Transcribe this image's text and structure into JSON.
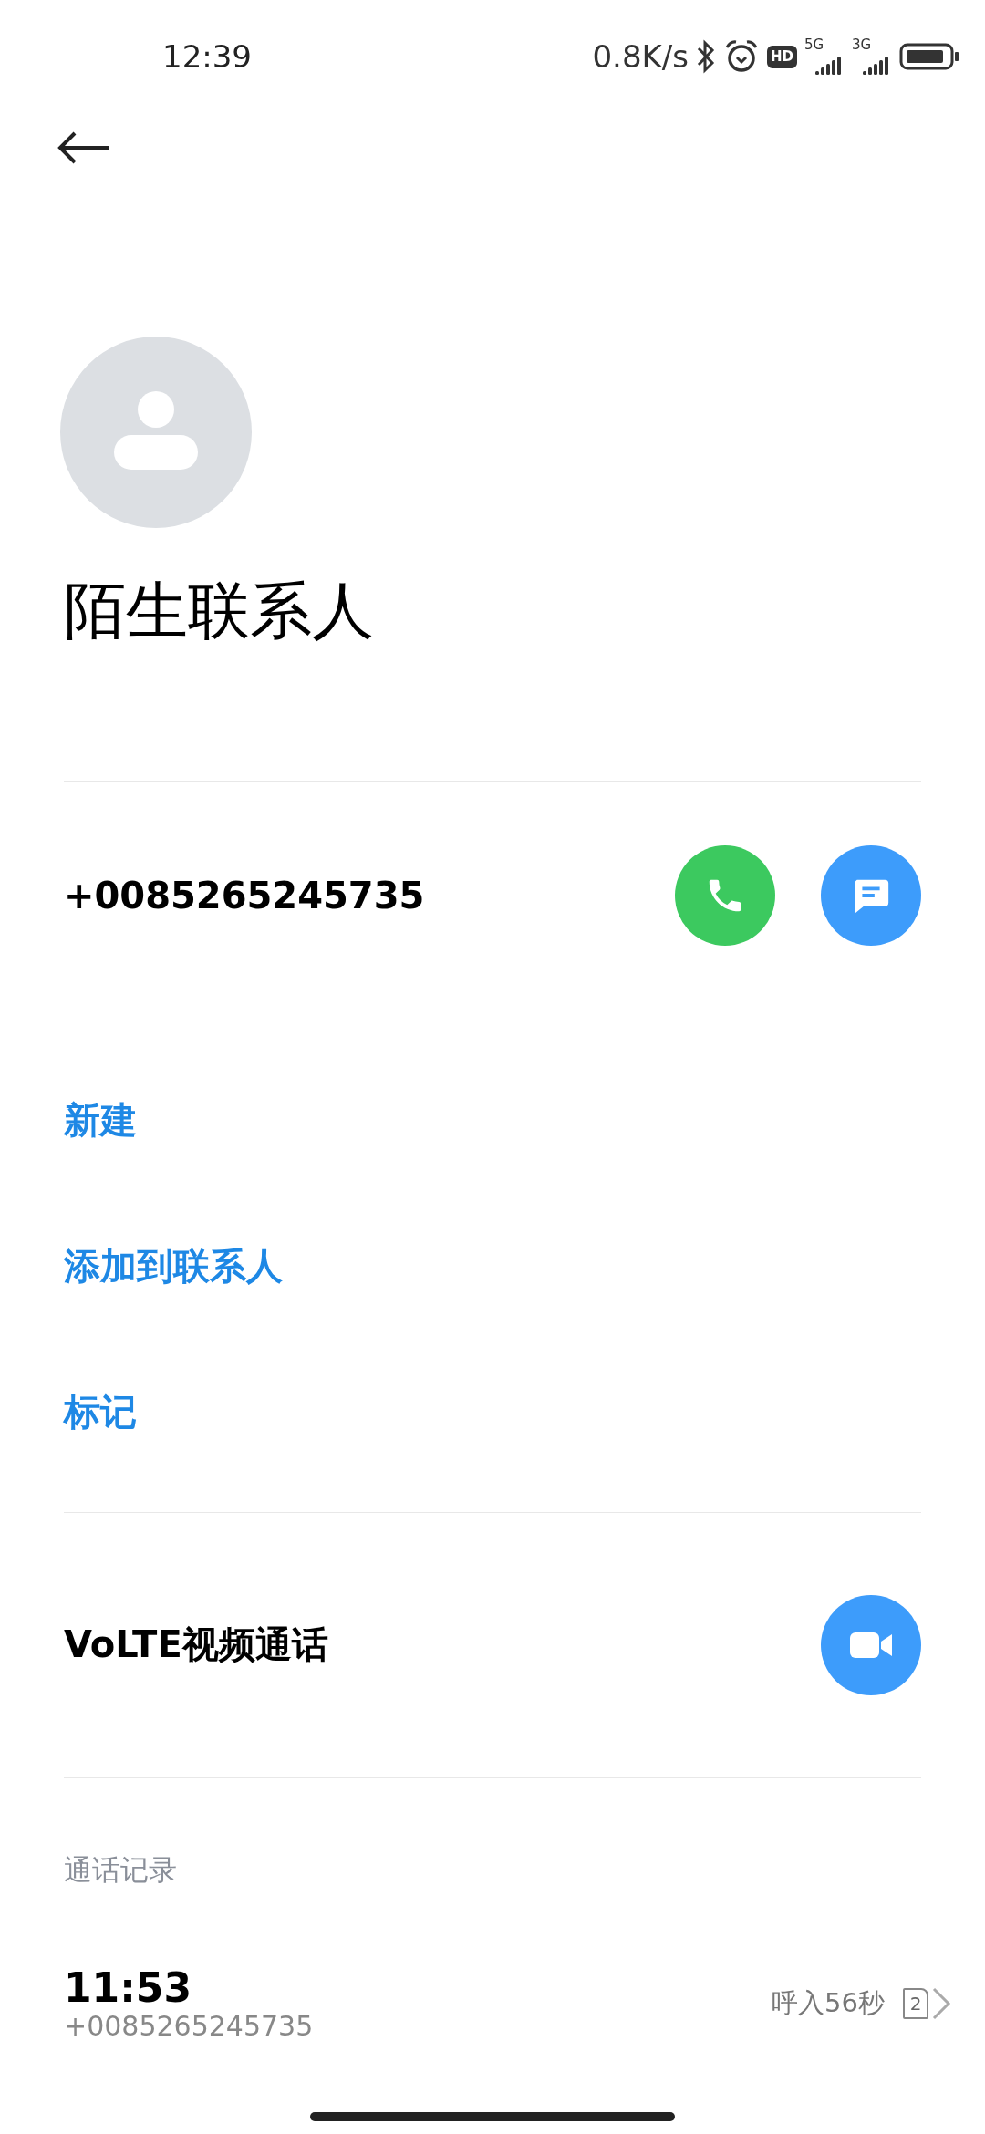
{
  "status_bar": {
    "time": "12:39",
    "net_speed": "0.8K/s",
    "hd_badge": "HD",
    "sim_1_network": "5G",
    "sim_2_network": "3G"
  },
  "contact": {
    "name": "陌生联系人"
  },
  "phone": {
    "number": "+0085265245735"
  },
  "actions": [
    {
      "label": "新建"
    },
    {
      "label": "添加到联系人"
    },
    {
      "label": "标记"
    }
  ],
  "video_call": {
    "label": "VoLTE视频通话"
  },
  "call_log": {
    "heading": "通话记录",
    "entries": [
      {
        "time": "11:53",
        "number": "+0085265245735",
        "detail": "呼入56秒",
        "sim": "2"
      }
    ]
  }
}
